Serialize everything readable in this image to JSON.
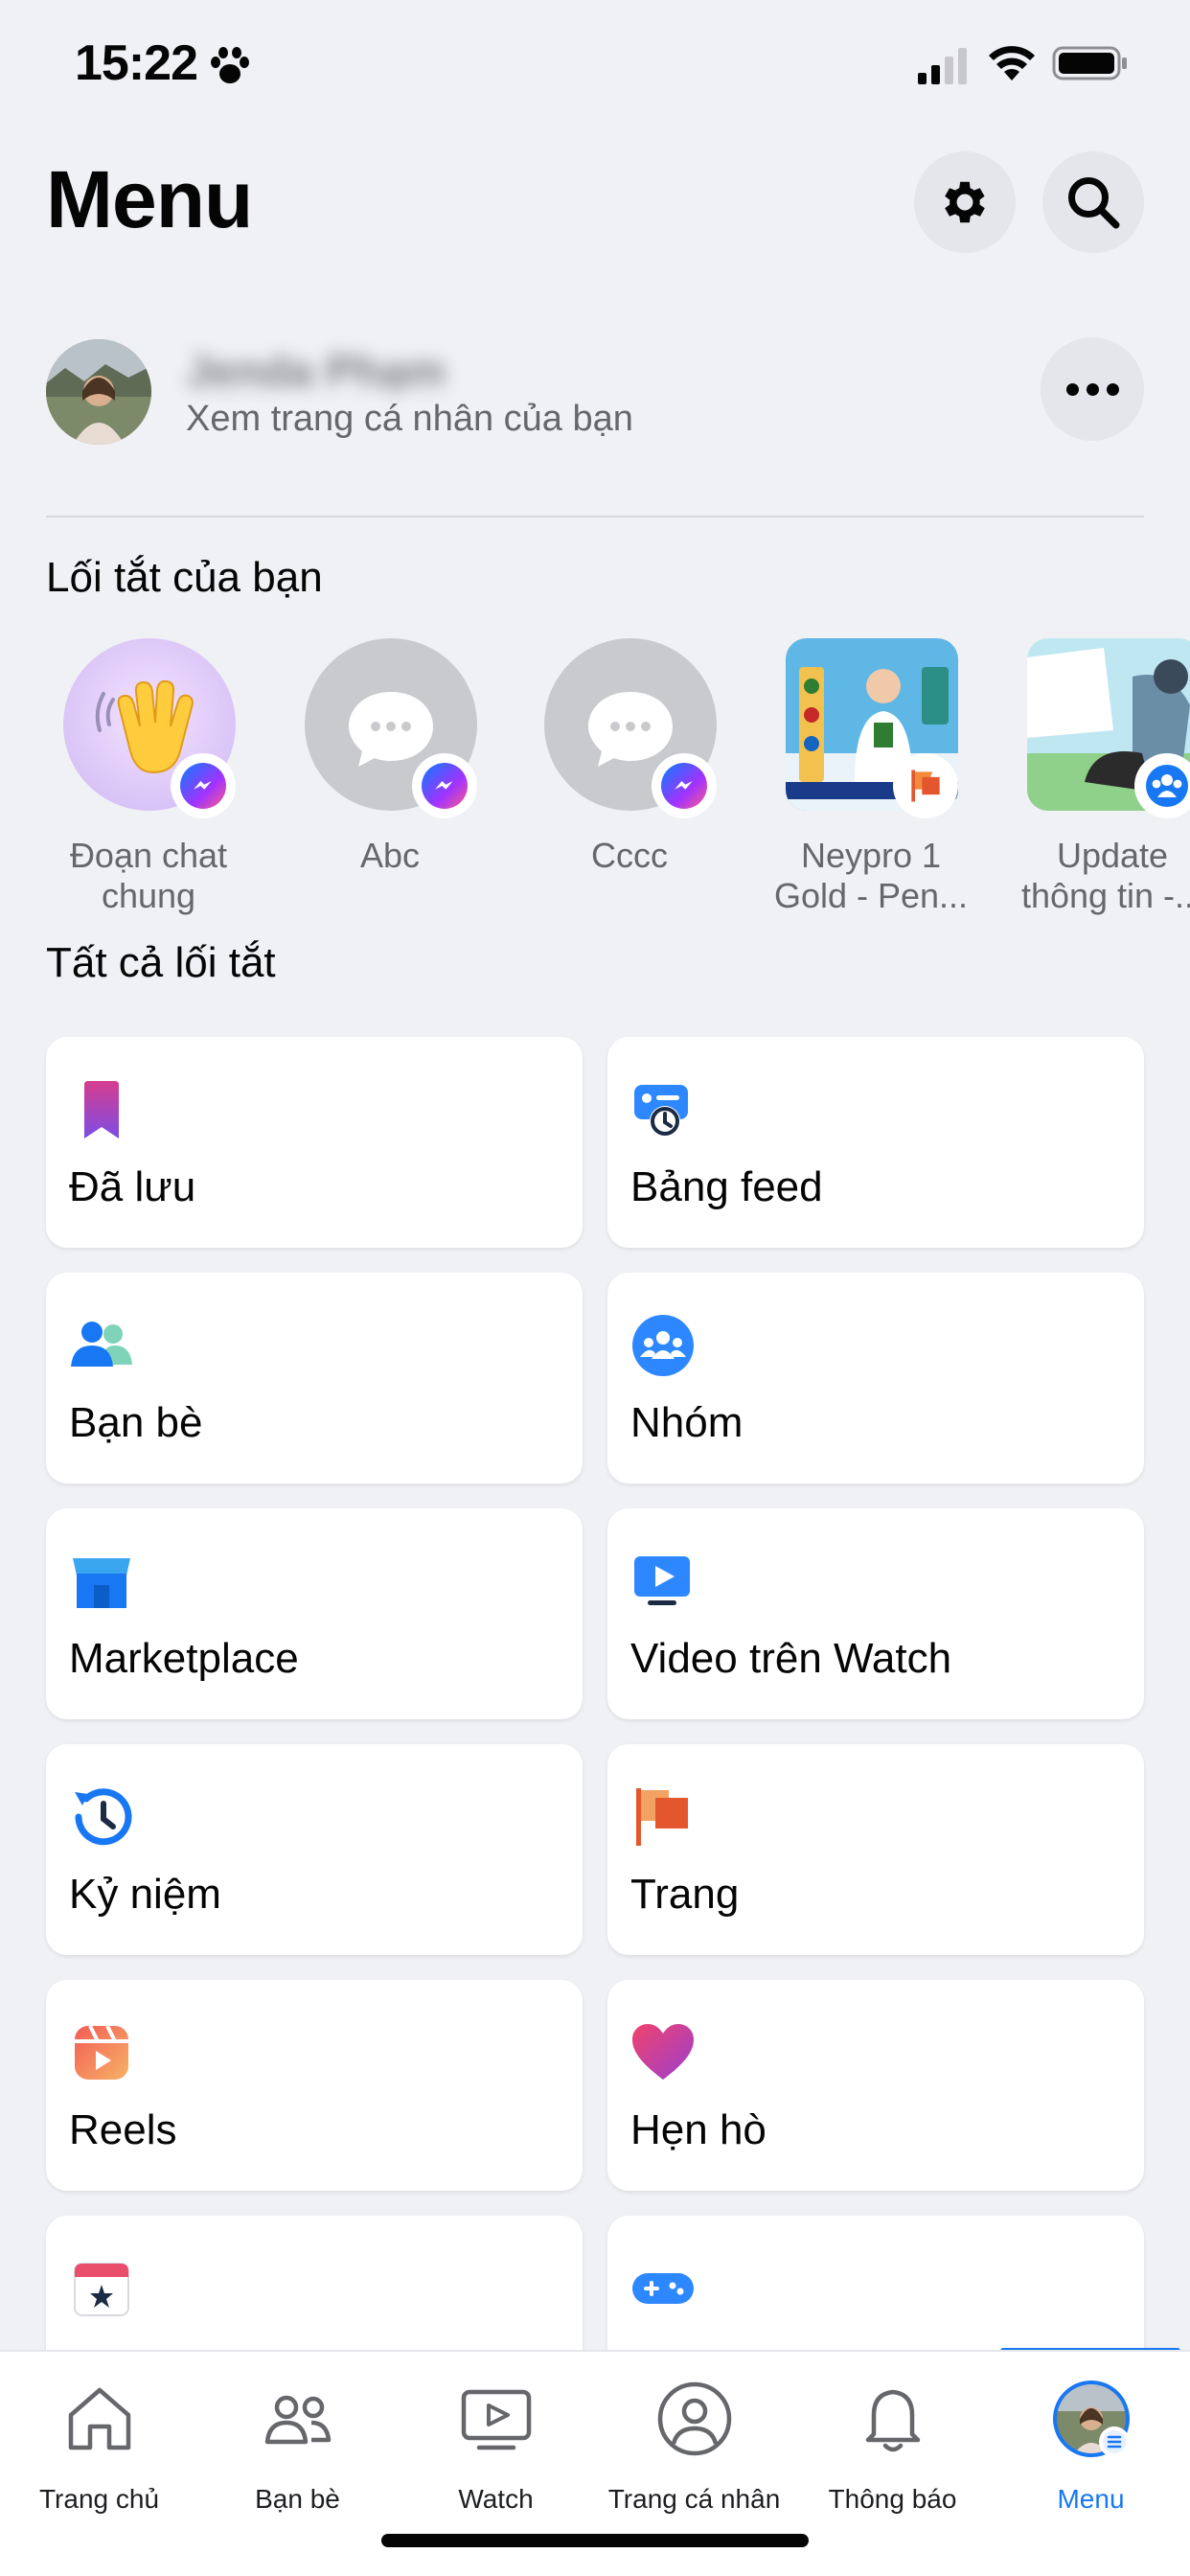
{
  "status": {
    "time": "15:22"
  },
  "header": {
    "title": "Menu"
  },
  "profile": {
    "name": "Jenda Phạm",
    "subtitle": "Xem trang cá nhân của bạn"
  },
  "sections": {
    "shortcuts": "Lối tắt của bạn",
    "all_shortcuts": "Tất cả lối tắt"
  },
  "shortcuts": [
    {
      "label": "Đoạn chat\nchung",
      "icon": "waving-hand-icon",
      "badge": "messenger-icon"
    },
    {
      "label": "Abc",
      "icon": "chat-bubble-icon",
      "badge": "messenger-icon"
    },
    {
      "label": "Cccc",
      "icon": "chat-bubble-icon",
      "badge": "messenger-icon"
    },
    {
      "label": "Neypro 1\nGold - Pen...",
      "icon": "page-thumbnail",
      "badge": "pages-flag-icon"
    },
    {
      "label": "Update\nthông tin -...",
      "icon": "group-thumbnail",
      "badge": "groups-icon"
    }
  ],
  "grid": [
    {
      "label": "Đã lưu",
      "icon": "bookmark-icon"
    },
    {
      "label": "Bảng feed",
      "icon": "feed-clock-icon"
    },
    {
      "label": "Bạn bè",
      "icon": "friends-icon"
    },
    {
      "label": "Nhóm",
      "icon": "groups-icon"
    },
    {
      "label": "Marketplace",
      "icon": "marketplace-store-icon"
    },
    {
      "label": "Video trên Watch",
      "icon": "watch-video-icon"
    },
    {
      "label": "Kỷ niệm",
      "icon": "memories-clock-icon"
    },
    {
      "label": "Trang",
      "icon": "pages-flag-icon"
    },
    {
      "label": "Reels",
      "icon": "reels-icon"
    },
    {
      "label": "Hẹn hò",
      "icon": "dating-heart-icon"
    },
    {
      "label": "",
      "icon": "events-calendar-icon"
    },
    {
      "label": "",
      "icon": "gaming-controller-icon"
    }
  ],
  "tabs": [
    {
      "label": "Trang chủ",
      "icon": "home-icon"
    },
    {
      "label": "Bạn bè",
      "icon": "friends-icon"
    },
    {
      "label": "Watch",
      "icon": "watch-icon"
    },
    {
      "label": "Trang cá nhân",
      "icon": "profile-icon"
    },
    {
      "label": "Thông báo",
      "icon": "bell-icon"
    },
    {
      "label": "Menu",
      "icon": "menu-avatar-icon",
      "active": true
    }
  ],
  "colors": {
    "accent": "#1877f2",
    "background": "#f0f1f5",
    "card": "#ffffff",
    "secondary_text": "#65676b"
  }
}
